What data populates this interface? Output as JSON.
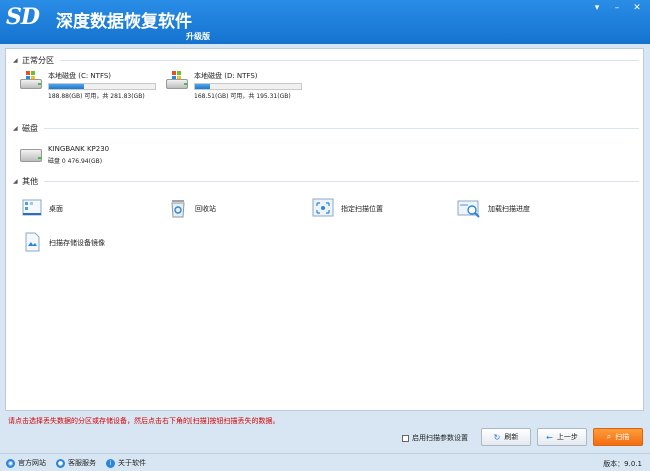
{
  "titlebar": {
    "logo_text": "SD",
    "title": "深度数据恢复软件",
    "edition": "升级版"
  },
  "sections": {
    "partitions": "正常分区",
    "disks": "磁盘",
    "others": "其他"
  },
  "partitions": [
    {
      "name": "本地磁盘 (C: NTFS)",
      "size": "188.88(GB) 可用，共 281.83(GB)",
      "used_fraction": 0.33
    },
    {
      "name": "本地磁盘 (D: NTFS)",
      "size": "168.51(GB) 可用，共 195.31(GB)",
      "used_fraction": 0.14
    }
  ],
  "disk": {
    "name": "KINGBANK KP230",
    "size": "磁盘 0     476.94(GB)"
  },
  "others": [
    {
      "label": "桌面",
      "icon": "desktop-icon"
    },
    {
      "label": "回收站",
      "icon": "recycle-bin-icon"
    },
    {
      "label": "指定扫描位置",
      "icon": "scan-location-icon"
    },
    {
      "label": "加载扫描进度",
      "icon": "load-progress-icon"
    },
    {
      "label": "扫描存储设备镜像",
      "icon": "device-image-icon"
    }
  ],
  "hint": "请点击选择丢失数据的分区或存储设备，然后点击右下角的[扫描]按钮扫描丢失的数据。",
  "controls": {
    "checkbox_label": "启用扫描参数设置",
    "checkbox_checked": false,
    "refresh": "刷新",
    "back": "上一步",
    "scan": "扫描"
  },
  "statusbar": {
    "website": "官方网站",
    "support": "客服服务",
    "about": "关于软件",
    "version": "版本：9.0.1"
  },
  "colors": {
    "title_bg": "#1a7cd8",
    "scan_button": "#f47a1c",
    "hint_text": "#d40000",
    "progress_fill": "#2a86dd"
  }
}
